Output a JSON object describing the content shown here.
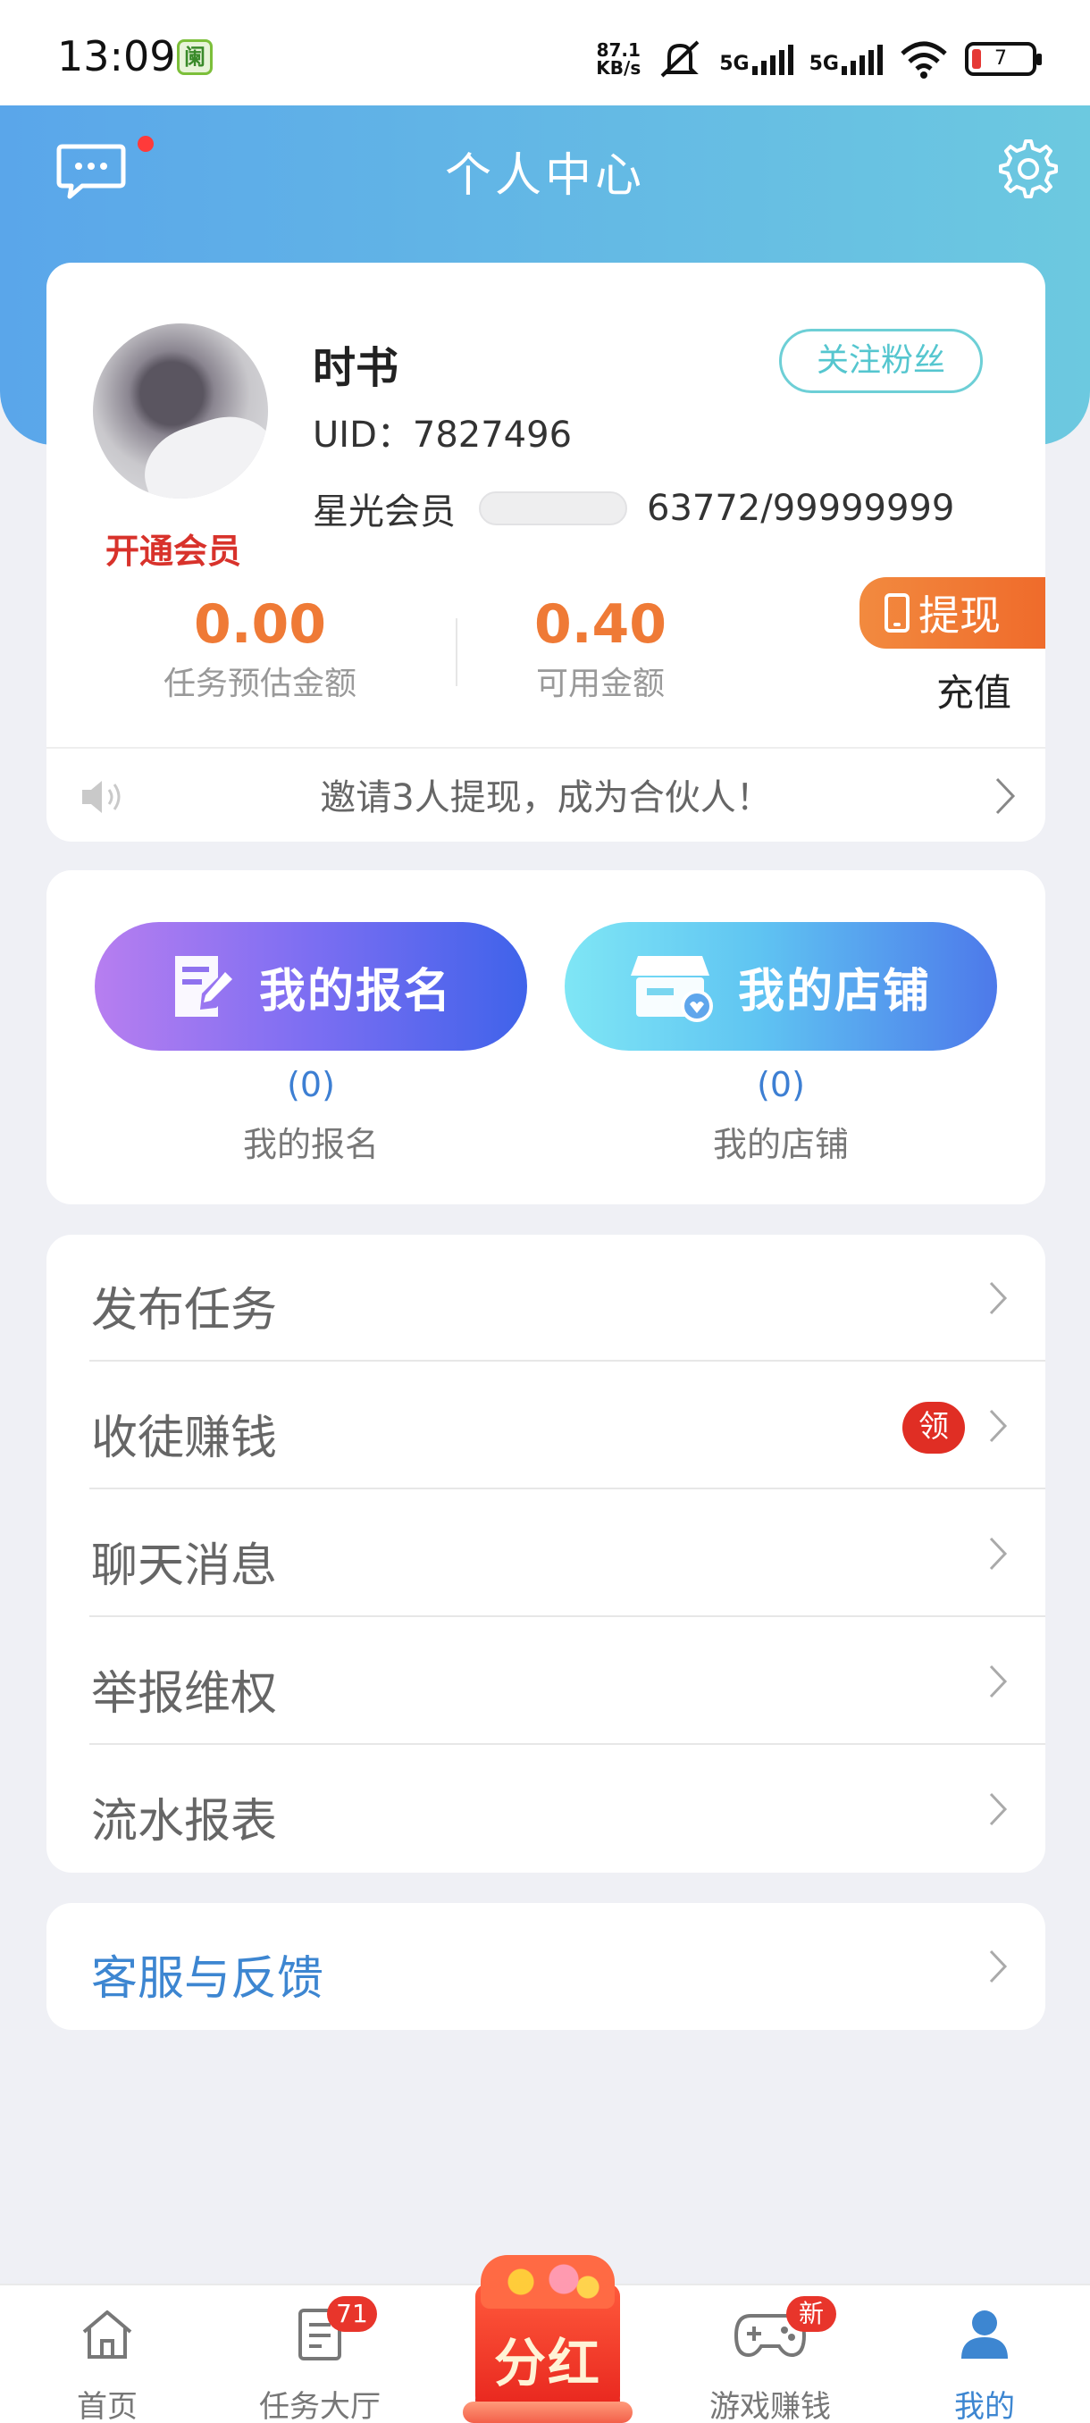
{
  "status_bar": {
    "time": "13:09",
    "app_icon_glyph": "阑",
    "net_speed_value": "87.1",
    "net_speed_unit": "KB/s",
    "signal1": "5G",
    "signal2": "5G",
    "battery": "7"
  },
  "header": {
    "title": "个人中心",
    "icons": [
      "chat-icon",
      "gear-icon"
    ]
  },
  "profile": {
    "nickname": "时书",
    "follow_button": "关注粉丝",
    "uid_label": "UID：",
    "uid_value": "7827496",
    "open_vip": "开通会员",
    "member_level": "星光会员",
    "member_progress": "63772/99999999",
    "task_estimate_value": "0.00",
    "task_estimate_label": "任务预估金额",
    "available_value": "0.40",
    "available_label": "可用金额",
    "withdraw_button": "提现",
    "recharge_label": "充值",
    "notice": "邀请3人提现，成为合伙人！"
  },
  "my_section": {
    "signup_button": "我的报名",
    "signup_count": "(0)",
    "signup_label": "我的报名",
    "shop_button": "我的店铺",
    "shop_count": "(0)",
    "shop_label": "我的店铺"
  },
  "menu": {
    "items": [
      {
        "label": "发布任务"
      },
      {
        "label": "收徒赚钱",
        "badge": "领"
      },
      {
        "label": "聊天消息"
      },
      {
        "label": "举报维权"
      },
      {
        "label": "流水报表"
      }
    ],
    "service": "客服与反馈"
  },
  "bottom_nav": {
    "home": "首页",
    "task_hall": "任务大厅",
    "task_hall_badge": "71",
    "center": "分红",
    "game": "游戏赚钱",
    "game_badge": "新",
    "mine": "我的"
  },
  "colors": {
    "accent_blue": "#3d86d1",
    "amount_orange": "#ef7a36",
    "vip_red": "#d8322b"
  }
}
